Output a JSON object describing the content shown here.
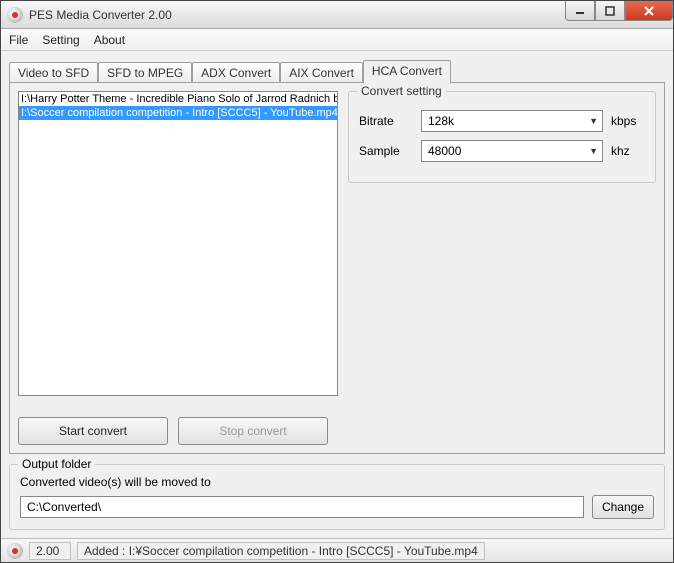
{
  "window": {
    "title": "PES Media Converter 2.00"
  },
  "menu": {
    "file": "File",
    "setting": "Setting",
    "about": "About"
  },
  "tabs": {
    "video_to_sfd": "Video to SFD",
    "sfd_to_mpeg": "SFD to MPEG",
    "adx_convert": "ADX Convert",
    "aix_convert": "AIX Convert",
    "hca_convert": "HCA Convert"
  },
  "file_list": [
    "I:\\Harry Potter Theme - Incredible Piano Solo of Jarrod Radnich by The",
    "I:\\Soccer compilation competition - Intro [SCCC5] - YouTube.mp4"
  ],
  "file_list_selected_index": 1,
  "convert_settings": {
    "legend": "Convert setting",
    "bitrate_label": "Bitrate",
    "bitrate_value": "128k",
    "bitrate_unit": "kbps",
    "sample_label": "Sample",
    "sample_value": "48000",
    "sample_unit": "khz"
  },
  "buttons": {
    "start": "Start convert",
    "stop": "Stop convert",
    "change": "Change"
  },
  "output": {
    "legend": "Output folder",
    "hint": "Converted video(s) will be moved to",
    "path": "C:\\Converted\\"
  },
  "status": {
    "version": "2.00",
    "message": "Added : I:¥Soccer compilation competition - Intro [SCCC5] - YouTube.mp4"
  }
}
